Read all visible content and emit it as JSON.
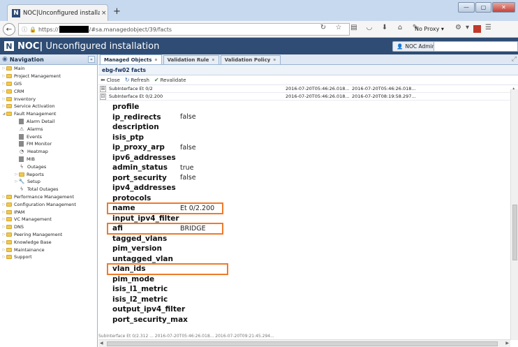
{
  "browser": {
    "tab_title": "NOC|Unconfigured installa...",
    "tab_close": "×",
    "new_tab": "+",
    "url_prefix": "https://",
    "url_suffix": "/#sa.managedobject/39/facts",
    "proxy_label": "No Proxy ▾",
    "window_min": "—",
    "window_max": "▢",
    "window_close": "✕"
  },
  "app": {
    "logo": "N",
    "title_bold": "NOC|",
    "title_rest": " Unconfigured installation",
    "user_button": "NOC Admin ▾"
  },
  "navigation": {
    "header": "Navigation",
    "items": [
      {
        "label": "Main",
        "type": "folder",
        "level": 0
      },
      {
        "label": "Project Management",
        "type": "folder",
        "level": 0
      },
      {
        "label": "GIS",
        "type": "folder",
        "level": 0
      },
      {
        "label": "CRM",
        "type": "folder",
        "level": 0
      },
      {
        "label": "Inventory",
        "type": "folder",
        "level": 0
      },
      {
        "label": "Service Activation",
        "type": "folder",
        "level": 0
      },
      {
        "label": "Fault Management",
        "type": "folder-open",
        "level": 0
      },
      {
        "label": "Alarm Detail",
        "type": "doc",
        "level": 1
      },
      {
        "label": "Alarms",
        "type": "warning",
        "level": 1
      },
      {
        "label": "Events",
        "type": "doc",
        "level": 1
      },
      {
        "label": "FM Monitor",
        "type": "doc",
        "level": 1
      },
      {
        "label": "Heatmap",
        "type": "gear",
        "level": 1
      },
      {
        "label": "MIB",
        "type": "doc",
        "level": 1
      },
      {
        "label": "Outages",
        "type": "bolt",
        "level": 1
      },
      {
        "label": "Reports",
        "type": "folder",
        "level": 1
      },
      {
        "label": "Setup",
        "type": "wrench",
        "level": 1
      },
      {
        "label": "Total Outages",
        "type": "bolt",
        "level": 1
      },
      {
        "label": "Performance Management",
        "type": "folder",
        "level": 0
      },
      {
        "label": "Configuration Management",
        "type": "folder",
        "level": 0
      },
      {
        "label": "IPAM",
        "type": "folder",
        "level": 0
      },
      {
        "label": "VC Management",
        "type": "folder",
        "level": 0
      },
      {
        "label": "DNS",
        "type": "folder",
        "level": 0
      },
      {
        "label": "Peering Management",
        "type": "folder",
        "level": 0
      },
      {
        "label": "Knowledge Base",
        "type": "folder",
        "level": 0
      },
      {
        "label": "Maintainance",
        "type": "folder",
        "level": 0
      },
      {
        "label": "Support",
        "type": "folder",
        "level": 0
      }
    ]
  },
  "main": {
    "tabs": [
      {
        "label": "Managed Objects",
        "active": true
      },
      {
        "label": "Validation Rule",
        "active": false
      },
      {
        "label": "Validation Policy",
        "active": false
      }
    ],
    "panel_title": "ebg-fw02 facts",
    "toolbar": {
      "close": "Close",
      "refresh": "Refresh",
      "revalidate": "Revalidate"
    },
    "grid_rows": [
      {
        "expander": "⊞",
        "name": "SubInterface Et 0/2",
        "date1": "2016-07-20T05:46:26.018...",
        "date2": "2016-07-20T05:46:26.018..."
      },
      {
        "expander": "⊟",
        "name": "SubInterface Et 0/2.200",
        "date1": "2016-07-20T05:46:26.018...",
        "date2": "2016-07-20T08:19:58.297..."
      }
    ],
    "facts": [
      {
        "key": "profile",
        "value": ""
      },
      {
        "key": "ip_redirects",
        "value": "false"
      },
      {
        "key": "description",
        "value": ""
      },
      {
        "key": "isis_ptp",
        "value": ""
      },
      {
        "key": "ip_proxy_arp",
        "value": "false"
      },
      {
        "key": "ipv6_addresses",
        "value": ""
      },
      {
        "key": "admin_status",
        "value": "true"
      },
      {
        "key": "port_security",
        "value": "false"
      },
      {
        "key": "ipv4_addresses",
        "value": ""
      },
      {
        "key": "protocols",
        "value": ""
      },
      {
        "key": "name",
        "value": "Et 0/2.200"
      },
      {
        "key": "input_ipv4_filter",
        "value": ""
      },
      {
        "key": "afi",
        "value": "BRIDGE"
      },
      {
        "key": "tagged_vlans",
        "value": ""
      },
      {
        "key": "pim_version",
        "value": ""
      },
      {
        "key": "untagged_vlan",
        "value": ""
      },
      {
        "key": "vlan_ids",
        "value": ""
      },
      {
        "key": "pim_mode",
        "value": ""
      },
      {
        "key": "isis_l1_metric",
        "value": ""
      },
      {
        "key": "isis_l2_metric",
        "value": ""
      },
      {
        "key": "output_ipv4_filter",
        "value": ""
      },
      {
        "key": "port_security_max",
        "value": ""
      }
    ],
    "highlighted_keys": [
      "name",
      "afi",
      "vlan_ids"
    ],
    "highlight_color": "#ef7a2a",
    "bottom_partial_row": "SubInterface Et 0/2.312 ... 2016-07-20T05:46:26.018... 2016-07-20T09:21:45.294..."
  }
}
